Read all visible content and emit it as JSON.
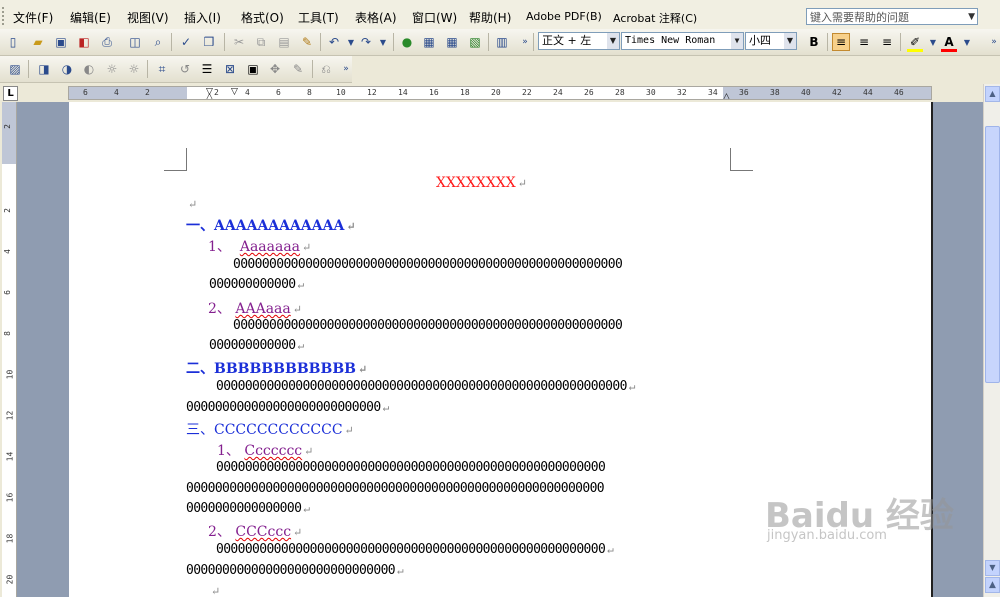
{
  "menu": {
    "items": [
      "文件(F)",
      "编辑(E)",
      "视图(V)",
      "插入(I)",
      "格式(O)",
      "工具(T)",
      "表格(A)",
      "窗口(W)",
      "帮助(H)",
      "Adobe PDF(B)",
      "Acrobat 注释(C)"
    ],
    "help_placeholder": "键入需要帮助的问题"
  },
  "formatting": {
    "style": "正文 + 左",
    "font": "Times New Roman",
    "size": "小四",
    "bold_label": "B",
    "highlight_color": "#ffff00",
    "font_color": "#ff0000"
  },
  "ruler": {
    "corner_label": "L",
    "h_numbers": [
      "6",
      "4",
      "2",
      "",
      "2",
      "4",
      "6",
      "8",
      "10",
      "12",
      "14",
      "16",
      "18",
      "20",
      "22",
      "24",
      "26",
      "28",
      "30",
      "32",
      "34",
      "36",
      "38",
      "40",
      "42",
      "44",
      "46"
    ],
    "v_numbers": [
      "2",
      "",
      "2",
      "4",
      "6",
      "8",
      "10",
      "12",
      "14",
      "16",
      "18",
      "20"
    ]
  },
  "document": {
    "title": "XXXXXXXX",
    "h1": {
      "num": "一、",
      "text": "AAAAAAAAAAAA"
    },
    "a1": {
      "num": "1、",
      "text": "Aaaaaaa"
    },
    "a1_line1": "000000000000000000000000000000000000000000000000000000",
    "a1_line2": "000000000000",
    "a2": {
      "num": "2、",
      "text": "AAAaaa"
    },
    "a2_line1": "000000000000000000000000000000000000000000000000000000",
    "a2_line2": "000000000000",
    "h2": {
      "num": "二、",
      "text": "BBBBBBBBBBBB"
    },
    "b_line1": "000000000000000000000000000000000000000000000000000000000",
    "b_line2": "000000000000000000000000000",
    "h3": {
      "num": "三、",
      "text": "CCCCCCCCCCCC"
    },
    "c1": {
      "num": "1、",
      "text": "Ccccccc"
    },
    "c1_line1": "000000000000000000000000000000000000000000000000000000",
    "c1_line2": "0000000000000000000000000000000000000000000000000000000000",
    "c1_line3": "0000000000000000",
    "c2": {
      "num": "2、",
      "text": "CCCccc"
    },
    "c2_line1": "000000000000000000000000000000000000000000000000000000",
    "c2_line2": "00000000000000000000000000000",
    "para_mark": "↵"
  },
  "watermark": {
    "brand": "Baidu 经验",
    "url": "jingyan.baidu.com"
  },
  "colors": {
    "heading": "#1b2fd8",
    "subheading": "#84208f",
    "title": "#ff1a1a",
    "page_bg": "#8f9cb1"
  }
}
